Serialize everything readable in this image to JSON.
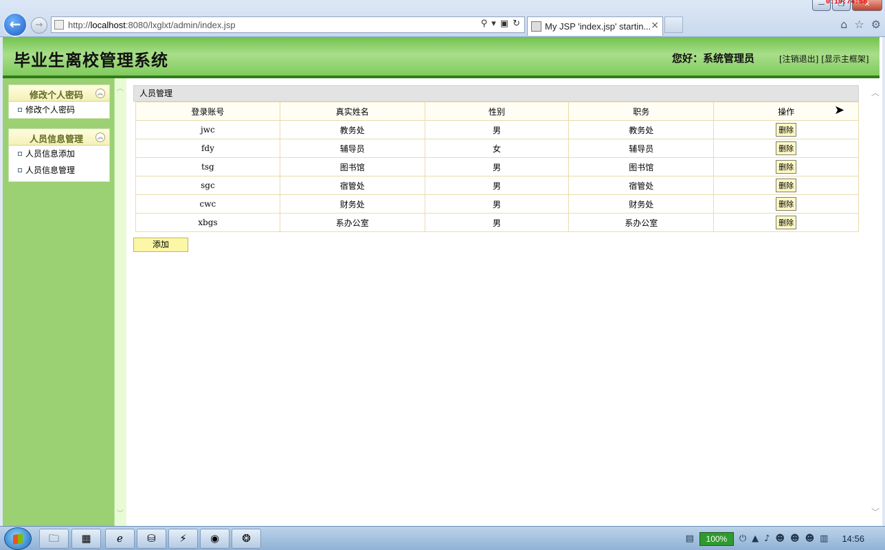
{
  "browser": {
    "url_prefix": "http://",
    "url_host": "localhost",
    "url_rest": ":8080/lxglxt/admin/index.jsp",
    "tab_title": "My JSP 'index.jsp' startin...",
    "tab_close": "×",
    "overlay_clock": "0:19:74:58"
  },
  "header": {
    "system_title": "毕业生离校管理系统",
    "greeting": "您好：系统管理员",
    "logout_link": "[注销退出]",
    "show_frame_link": "[显示主框架]"
  },
  "sidebar": {
    "groups": [
      {
        "title": "修改个人密码",
        "items": [
          {
            "label": "修改个人密码"
          }
        ]
      },
      {
        "title": "人员信息管理",
        "items": [
          {
            "label": "人员信息添加"
          },
          {
            "label": "人员信息管理"
          }
        ]
      }
    ]
  },
  "content": {
    "panel_title": "人员管理",
    "columns": [
      "登录账号",
      "真实姓名",
      "性别",
      "职务",
      "操作"
    ],
    "rows": [
      {
        "account": "jwc",
        "name": "教务处",
        "gender": "男",
        "role": "教务处",
        "action": "删除"
      },
      {
        "account": "fdy",
        "name": "辅导员",
        "gender": "女",
        "role": "辅导员",
        "action": "删除"
      },
      {
        "account": "tsg",
        "name": "图书馆",
        "gender": "男",
        "role": "图书馆",
        "action": "删除"
      },
      {
        "account": "sgc",
        "name": "宿管处",
        "gender": "男",
        "role": "宿管处",
        "action": "删除"
      },
      {
        "account": "cwc",
        "name": "财务处",
        "gender": "男",
        "role": "财务处",
        "action": "删除"
      },
      {
        "account": "xbgs",
        "name": "系办公室",
        "gender": "男",
        "role": "系办公室",
        "action": "删除"
      }
    ],
    "add_button": "添加"
  },
  "taskbar": {
    "battery": "100%",
    "clock": "14:56"
  }
}
